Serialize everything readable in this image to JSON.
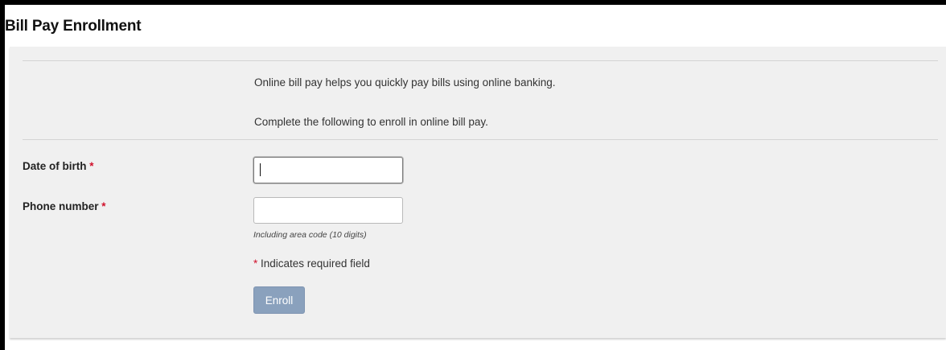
{
  "page": {
    "title": "Bill Pay Enrollment"
  },
  "intro": {
    "line1": "Online bill pay helps you quickly pay bills using online banking.",
    "line2": "Complete the following to enroll in online bill pay."
  },
  "form": {
    "date_of_birth": {
      "label": "Date of birth",
      "required_mark": "*",
      "value": ""
    },
    "phone_number": {
      "label": "Phone number",
      "required_mark": "*",
      "value": "",
      "hint": "Including area code (10 digits)"
    },
    "required_note": {
      "mark": "*",
      "text": " Indicates required field"
    },
    "enroll_label": "Enroll"
  },
  "colors": {
    "required": "#d0112b",
    "button_bg": "#8aa1bd",
    "panel_bg": "#f0f0f0"
  }
}
